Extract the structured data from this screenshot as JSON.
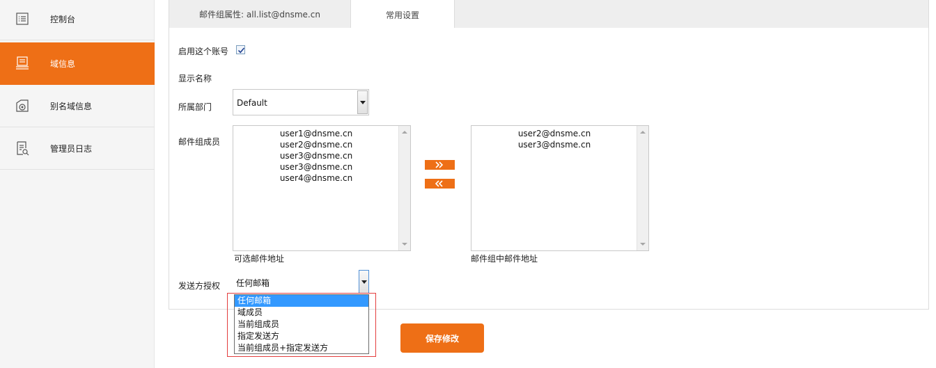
{
  "sidebar": {
    "items": [
      {
        "label": "控制台",
        "icon": "list-icon"
      },
      {
        "label": "域信息",
        "icon": "layers-icon",
        "active": true
      },
      {
        "label": "别名域信息",
        "icon": "camera-icon"
      },
      {
        "label": "管理员日志",
        "icon": "log-search-icon"
      }
    ],
    "accent": "#ee6f16"
  },
  "tabs": [
    {
      "label": "邮件组属性: all.list@dnsme.cn"
    },
    {
      "label": "常用设置",
      "active": true
    }
  ],
  "form": {
    "enable_label": "启用这个账号",
    "enable_checked": true,
    "display_name_label": "显示名称",
    "department_label": "所属部门",
    "department_value": "Default",
    "members_label": "邮件组成员",
    "available": {
      "items": [
        "user1@dnsme.cn",
        "user2@dnsme.cn",
        "user3@dnsme.cn",
        "user3@dnsme.cn",
        "user4@dnsme.cn"
      ],
      "caption": "可选邮件地址"
    },
    "selected": {
      "items": [
        "user2@dnsme.cn",
        "user3@dnsme.cn"
      ],
      "caption": "邮件组中邮件地址"
    },
    "sender_label": "发送方授权",
    "sender_value": "任何邮箱",
    "sender_options": [
      "任何邮箱",
      "域成员",
      "当前组成员",
      "指定发送方",
      "当前组成员+指定发送方"
    ]
  },
  "save_label": "保存修改"
}
